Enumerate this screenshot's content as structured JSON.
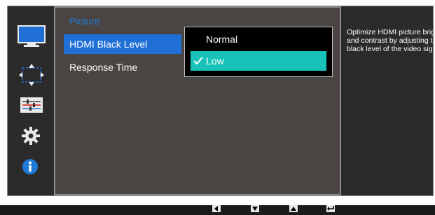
{
  "sidebar": {
    "icons": [
      "monitor-icon",
      "position-arrows-icon",
      "color-sliders-icon",
      "settings-gear-icon",
      "information-icon"
    ]
  },
  "menu": {
    "title": "Picture",
    "items": [
      {
        "label": "HDMI Black Level",
        "selected": true
      },
      {
        "label": "Response Time",
        "selected": false
      }
    ]
  },
  "dropdown": {
    "options": [
      {
        "label": "Normal",
        "selected": false
      },
      {
        "label": "Low",
        "selected": true
      }
    ]
  },
  "description": {
    "text": "Optimize HDMI picture brightness and contrast by adjusting the black level of the video signal."
  },
  "bottom_buttons": [
    "left-arrow-icon",
    "down-arrow-icon",
    "up-arrow-icon",
    "enter-icon"
  ],
  "colors": {
    "accent_blue": "#1f6fd6",
    "menu_title_blue": "#1f7bd6",
    "selected_option_teal": "#19c2b8",
    "panel_bg": "#4a4542",
    "osd_bg": "#2b2b2b"
  }
}
